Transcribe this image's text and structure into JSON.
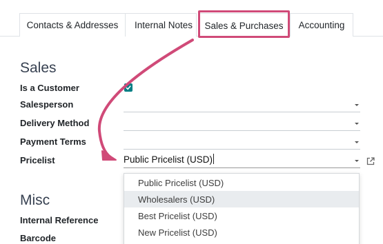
{
  "tabs": [
    {
      "label": "Contacts & Addresses"
    },
    {
      "label": "Internal Notes"
    },
    {
      "label": "Sales & Purchases"
    },
    {
      "label": "Accounting"
    }
  ],
  "active_tab": "Sales & Purchases",
  "sales_section": {
    "title": "Sales",
    "is_customer_label": "Is a Customer",
    "is_customer_checked": true,
    "salesperson_label": "Salesperson",
    "salesperson_value": "",
    "delivery_method_label": "Delivery Method",
    "delivery_method_value": "",
    "payment_terms_label": "Payment Terms",
    "payment_terms_value": "",
    "pricelist_label": "Pricelist",
    "pricelist_value": "Public Pricelist (USD)"
  },
  "pricelist_dropdown": {
    "options": [
      {
        "label": "Public Pricelist (USD)"
      },
      {
        "label": "Wholesalers (USD)"
      },
      {
        "label": "Best Pricelist (USD)"
      },
      {
        "label": "New Pricelist (USD)"
      }
    ],
    "hovered": "Wholesalers (USD)"
  },
  "misc_section": {
    "title": "Misc",
    "internal_reference_label": "Internal Reference",
    "barcode_label": "Barcode"
  },
  "colors": {
    "accent": "#017e84",
    "annotation": "#d04a78"
  },
  "icons": {
    "caret": "caret-down-icon",
    "external": "external-link-icon",
    "check": "checkmark-icon"
  }
}
